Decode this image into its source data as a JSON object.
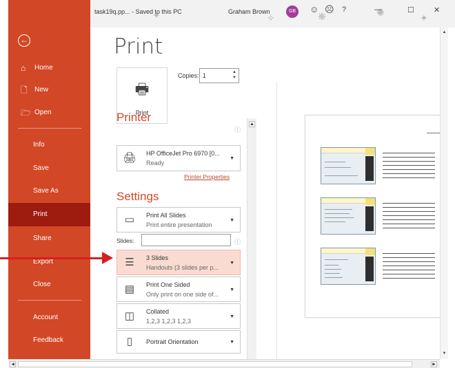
{
  "titlebar": {
    "doc_label": "task19q.pp... - Saved to this PC",
    "user_name": "Graham Brown",
    "avatar_initials": "GB",
    "help": "?",
    "minimize": "—",
    "restore": "☐",
    "close": "✕"
  },
  "nav": {
    "items": [
      {
        "label": "Home",
        "icon": "home-icon"
      },
      {
        "label": "New",
        "icon": "new-doc-icon"
      },
      {
        "label": "Open",
        "icon": "folder-icon"
      },
      {
        "label": "Info"
      },
      {
        "label": "Save"
      },
      {
        "label": "Save As"
      },
      {
        "label": "Print",
        "active": true
      },
      {
        "label": "Share"
      },
      {
        "label": "Export"
      },
      {
        "label": "Close"
      },
      {
        "label": "Account"
      },
      {
        "label": "Feedback"
      }
    ]
  },
  "print": {
    "title": "Print",
    "button_label": "Print",
    "copies_label": "Copies:",
    "copies_value": "1",
    "printer_heading": "Printer",
    "printer_name": "HP OfficeJet Pro 6970 [0...",
    "printer_status": "Ready",
    "printer_properties": "Printer Properties",
    "settings_heading": "Settings",
    "settings": [
      {
        "line1": "Print All Slides",
        "line2": "Print entire presentation",
        "icon": "slides-icon"
      },
      {
        "line1": "3 Slides",
        "line2": "Handouts (3 slides per p...",
        "icon": "handout-icon",
        "selected": true
      },
      {
        "line1": "Print One Sided",
        "line2": "Only print on one side of...",
        "icon": "one-sided-icon"
      },
      {
        "line1": "Collated",
        "line2": "1,2,3   1,2,3   1,2,3",
        "icon": "collated-icon"
      },
      {
        "line1": "Portrait Orientation",
        "line2": "",
        "icon": "portrait-icon"
      }
    ],
    "slides_label": "Slides:",
    "slides_value": ""
  },
  "colors": {
    "nav_bg": "#d24726",
    "nav_active": "#9e1b10",
    "accent_text": "#d24726",
    "selected_setting": "#fadbd2",
    "annotation_arrow": "#d81e1e"
  }
}
